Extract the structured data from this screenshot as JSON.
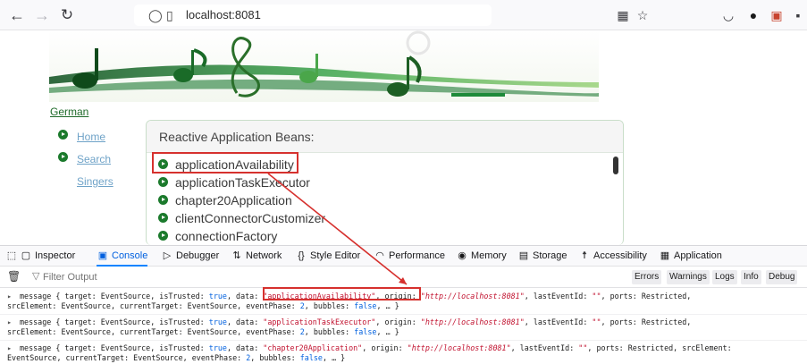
{
  "browser": {
    "url": "localhost:8081",
    "icons": [
      "back-icon",
      "forward-icon",
      "reload-icon",
      "shield-icon",
      "page-icon",
      "qr-icon",
      "star-icon",
      "pocket-icon",
      "profile-icon",
      "extension-icon"
    ]
  },
  "page": {
    "language_link": "German",
    "nav": [
      {
        "label": "Home"
      },
      {
        "label": "Search"
      },
      {
        "label": "Singers"
      }
    ],
    "panel_title": "Reactive Application Beans:",
    "beans": [
      "applicationAvailability",
      "applicationTaskExecutor",
      "chapter20Application",
      "clientConnectorCustomizer",
      "connectionFactory"
    ]
  },
  "devtools": {
    "tabs": [
      {
        "label": "Inspector",
        "icon": "inspector-icon"
      },
      {
        "label": "Console",
        "icon": "console-icon",
        "active": true
      },
      {
        "label": "Debugger",
        "icon": "debugger-icon"
      },
      {
        "label": "Network",
        "icon": "network-icon"
      },
      {
        "label": "Style Editor",
        "icon": "style-editor-icon"
      },
      {
        "label": "Performance",
        "icon": "performance-icon"
      },
      {
        "label": "Memory",
        "icon": "memory-icon"
      },
      {
        "label": "Storage",
        "icon": "storage-icon"
      },
      {
        "label": "Accessibility",
        "icon": "accessibility-icon"
      },
      {
        "label": "Application",
        "icon": "application-icon"
      }
    ],
    "filter_placeholder": "Filter Output",
    "levels": [
      "Errors",
      "Warnings",
      "Logs",
      "Info",
      "Debug"
    ],
    "messages": [
      {
        "line1": {
          "p1": "message { target: EventSource, isTrusted: ",
          "t1": "true",
          "p2": ", data: ",
          "s1": "\"applicationAvailability\"",
          "p3": ", origin: ",
          "u1": "\"http://localhost:8081\"",
          "p4": ", lastEventId: ",
          "s2": "\"\"",
          "p5": ", ports: Restricted,"
        },
        "line2": {
          "p1": "srcElement: EventSource, currentTarget: EventSource, eventPhase: ",
          "n1": "2",
          "p2": ", bubbles: ",
          "b1": "false",
          "p3": ", … }"
        }
      },
      {
        "line1": {
          "p1": "message { target: EventSource, isTrusted: ",
          "t1": "true",
          "p2": ", data: ",
          "s1": "\"applicationTaskExecutor\"",
          "p3": ", origin: ",
          "u1": "\"http://localhost:8081\"",
          "p4": ", lastEventId: ",
          "s2": "\"\"",
          "p5": ", ports: Restricted,"
        },
        "line2": {
          "p1": "srcElement: EventSource, currentTarget: EventSource, eventPhase: ",
          "n1": "2",
          "p2": ", bubbles: ",
          "b1": "false",
          "p3": ", … }"
        }
      },
      {
        "line1": {
          "p1": "message { target: EventSource, isTrusted: ",
          "t1": "true",
          "p2": ", data: ",
          "s1": "\"chapter20Application\"",
          "p3": ", origin: ",
          "u1": "\"http://localhost:8081\"",
          "p4": ", lastEventId: ",
          "s2": "\"\"",
          "p5": ", ports: Restricted, srcElement:"
        },
        "line2": {
          "p1": "EventSource, currentTarget: EventSource, eventPhase: ",
          "n1": "2",
          "p2": ", bubbles: ",
          "b1": "false",
          "p3": ", … }"
        }
      }
    ]
  },
  "colors": {
    "link_green": "#1f6b2a",
    "annotation_red": "#d6312e",
    "console_string": "#c1122f",
    "console_keyword": "#0060df"
  }
}
